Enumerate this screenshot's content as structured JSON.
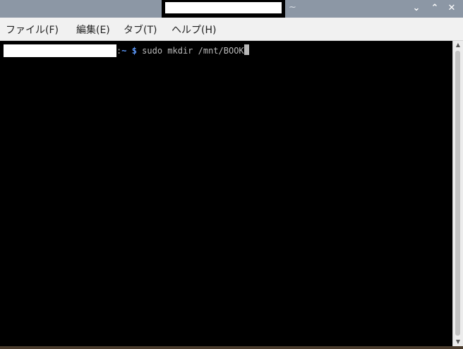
{
  "window": {
    "title": "~",
    "controls": {
      "minimize": "⌄",
      "maximize": "⌃",
      "close": "✕"
    }
  },
  "menubar": {
    "items": [
      {
        "label": "ファイル(F)"
      },
      {
        "label": "編集(E)"
      },
      {
        "label": "タブ(T)"
      },
      {
        "label": "ヘルプ(H)"
      }
    ]
  },
  "terminal": {
    "separator": ":",
    "path": "~",
    "dollar": "$",
    "command": " sudo mkdir /mnt/BOOK"
  },
  "colors": {
    "titlebar": "#8c97a5",
    "terminal_bg": "#000000",
    "prompt_blue": "#5e9bff",
    "command_text": "#bbbbbb"
  },
  "icons": {
    "minimize": "chevron-down-icon",
    "maximize": "chevron-up-icon",
    "close": "close-icon"
  }
}
